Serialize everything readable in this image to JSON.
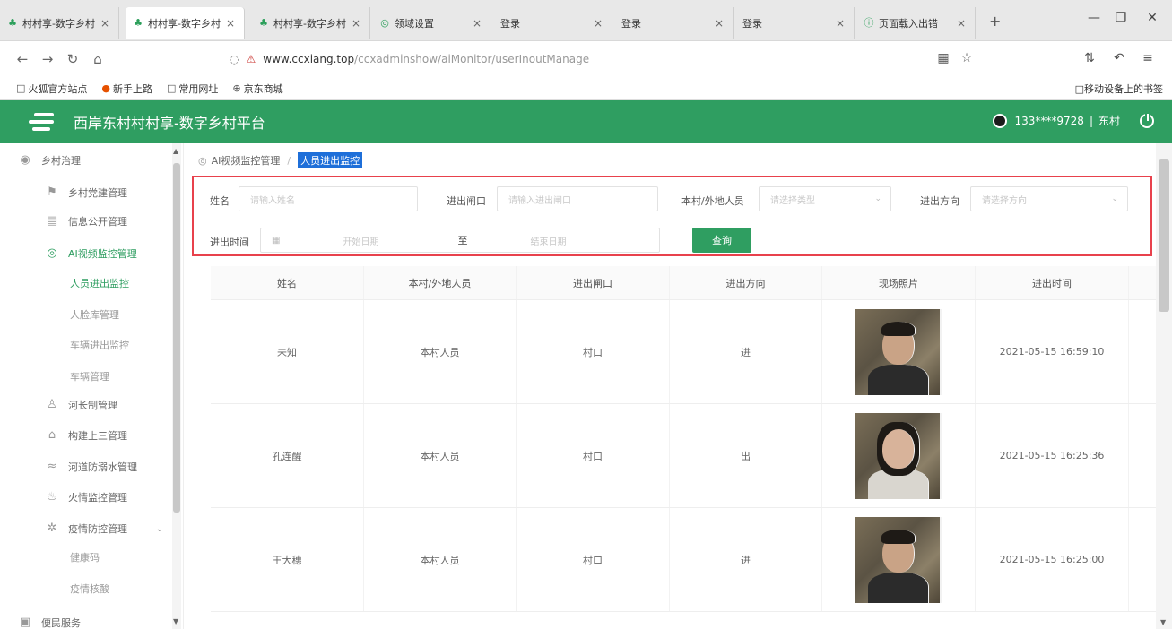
{
  "browser": {
    "tabs": [
      {
        "title": "村村享-数字乡村",
        "active": false
      },
      {
        "title": "村村享-数字乡村",
        "active": true
      },
      {
        "title": "村村享-数字乡村",
        "active": false
      },
      {
        "title": "领域设置",
        "active": false
      },
      {
        "title": "登录",
        "active": false
      },
      {
        "title": "登录",
        "active": false
      },
      {
        "title": "登录",
        "active": false
      },
      {
        "title": "页面载入出错",
        "active": false
      }
    ],
    "url_domain": "www.ccxiang.top",
    "url_path": "/ccxadminshow/aiMonitor/userInoutManage",
    "bookmarks": [
      "火狐官方站点",
      "新手上路",
      "常用网址",
      "京东商城"
    ],
    "mobile_bookmarks": "移动设备上的书签"
  },
  "app": {
    "title": "西岸东村村村享-数字乡村平台",
    "user": "133****9728",
    "org": "东村"
  },
  "sidebar": {
    "top_item": "乡村治理",
    "items": [
      {
        "label": "乡村党建管理"
      },
      {
        "label": "信息公开管理"
      },
      {
        "label": "AI视频监控管理"
      }
    ],
    "subitems": [
      "人员进出监控",
      "人脸库管理",
      "车辆进出监控",
      "车辆管理"
    ],
    "items2": [
      {
        "label": "河长制管理"
      },
      {
        "label": "构建上三管理"
      },
      {
        "label": "河道防溺水管理"
      },
      {
        "label": "火情监控管理"
      },
      {
        "label": "疫情防控管理"
      }
    ],
    "subitems2": [
      "健康码",
      "疫情核酸"
    ],
    "bottom_item": "便民服务"
  },
  "breadcrumb": {
    "parent": "AI视频监控管理",
    "current": "人员进出监控"
  },
  "filters": {
    "name_label": "姓名",
    "name_placeholder": "请输入姓名",
    "gate_label": "进出闸口",
    "gate_placeholder": "请输入进出闸口",
    "type_label": "本村/外地人员",
    "type_placeholder": "请选择类型",
    "direction_label": "进出方向",
    "direction_placeholder": "请选择方向",
    "time_label": "进出时间",
    "start_placeholder": "开始日期",
    "to": "至",
    "end_placeholder": "结束日期",
    "search_button": "查询"
  },
  "table": {
    "headers": [
      "姓名",
      "本村/外地人员",
      "进出闸口",
      "进出方向",
      "现场照片",
      "进出时间"
    ],
    "rows": [
      {
        "name": "未知",
        "type": "本村人员",
        "gate": "村口",
        "direction": "进",
        "time": "2021-05-15 16:59:10"
      },
      {
        "name": "孔连醒",
        "type": "本村人员",
        "gate": "村口",
        "direction": "出",
        "time": "2021-05-15 16:25:36"
      },
      {
        "name": "王大穗",
        "type": "本村人员",
        "gate": "村口",
        "direction": "进",
        "time": "2021-05-15 16:25:00"
      }
    ]
  }
}
